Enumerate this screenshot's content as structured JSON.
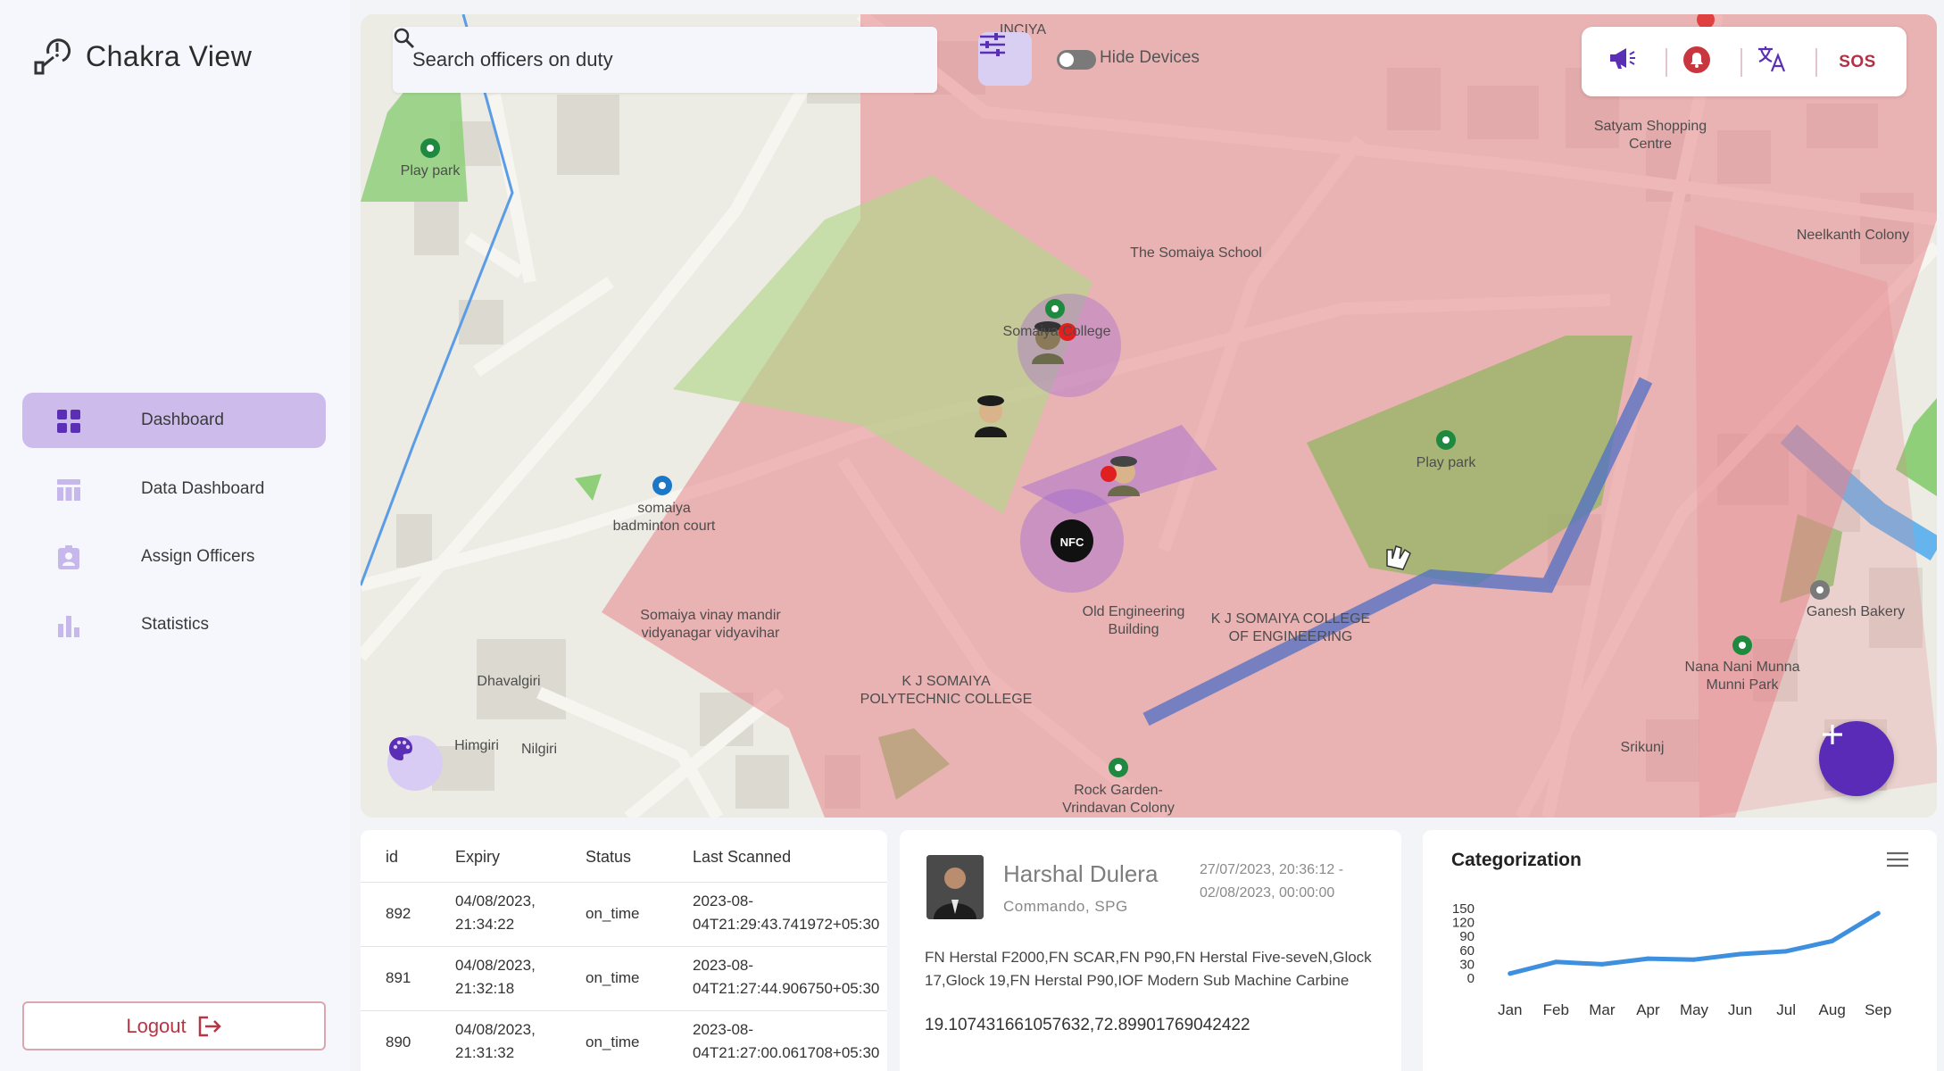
{
  "app": {
    "title": "Chakra View"
  },
  "sidebar": {
    "items": [
      {
        "label": "Dashboard",
        "icon": "grid-icon"
      },
      {
        "label": "Data Dashboard",
        "icon": "table-icon"
      },
      {
        "label": "Assign Officers",
        "icon": "badge-icon"
      },
      {
        "label": "Statistics",
        "icon": "bar-chart-icon"
      }
    ],
    "logout_label": "Logout"
  },
  "map": {
    "search_placeholder": "Search officers on duty",
    "hide_devices_label": "Hide Devices",
    "sos_label": "SOS",
    "nfc_label": "NFC",
    "labels": {
      "play_park_1": "Play park",
      "play_park_2": "Play park",
      "satyam": "Satyam Shopping\nCentre",
      "neelkanth": "Neelkanth Colony",
      "somaiya_school": "The Somaiya School",
      "somaiya_college": "Somaiya College",
      "badminton": "somaiya\nbadminton court",
      "vinay_mandir": "Somaiya vinay mandir\nvidyanagar vidyavihar",
      "old_eng": "Old Engineering\nBuilding",
      "kj_eng": "K J SOMAIYA COLLEGE\nOF ENGINEERING",
      "kj_poly": "K J SOMAIYA\nPOLYTECHNIC COLLEGE",
      "dhavalgiri": "Dhavalgiri",
      "himgiri": "Himgiri",
      "nilgiri": "Nilgiri",
      "rock_garden": "Rock Garden-\nVrindavan Colony",
      "srikunj": "Srikunj",
      "ganesh": "Ganesh Bakery",
      "nana_nani": "Nana Nani Munna\nMunni Park",
      "top_partial": "INCIYA"
    }
  },
  "scans_table": {
    "headers": [
      "id",
      "Expiry",
      "Status",
      "Last Scanned"
    ],
    "rows": [
      {
        "id": "892",
        "expiry_date": "04/08/2023,",
        "expiry_time": "21:34:22",
        "status": "on_time",
        "scanned_1": "2023-08-",
        "scanned_2": "04T21:29:43.741972+05:30"
      },
      {
        "id": "891",
        "expiry_date": "04/08/2023,",
        "expiry_time": "21:32:18",
        "status": "on_time",
        "scanned_1": "2023-08-",
        "scanned_2": "04T21:27:44.906750+05:30"
      },
      {
        "id": "890",
        "expiry_date": "04/08/2023,",
        "expiry_time": "21:31:32",
        "status": "on_time",
        "scanned_1": "2023-08-",
        "scanned_2": "04T21:27:00.061708+05:30"
      }
    ]
  },
  "officer": {
    "name": "Harshal Dulera",
    "role": "Commando, SPG",
    "time_from": "27/07/2023, 20:36:12 -",
    "time_to": "02/08/2023, 00:00:00",
    "weapons": "FN Herstal F2000,FN SCAR,FN P90,FN Herstal Five-seveN,Glock 17,Glock 19,FN Herstal P90,IOF Modern Sub Machine Carbine",
    "coordinates": "19.107431661057632,72.89901769042422"
  },
  "chart_data": {
    "type": "line",
    "title": "Categorization",
    "categories": [
      "Jan",
      "Feb",
      "Mar",
      "Apr",
      "May",
      "Jun",
      "Jul",
      "Aug",
      "Sep"
    ],
    "series": [
      {
        "values": [
          10,
          35,
          30,
          42,
          40,
          52,
          58,
          80,
          140
        ]
      }
    ],
    "yticks": [
      0,
      30,
      60,
      90,
      120,
      150
    ],
    "ylim": [
      0,
      150
    ],
    "grid": false,
    "color": "#3e8fde"
  }
}
